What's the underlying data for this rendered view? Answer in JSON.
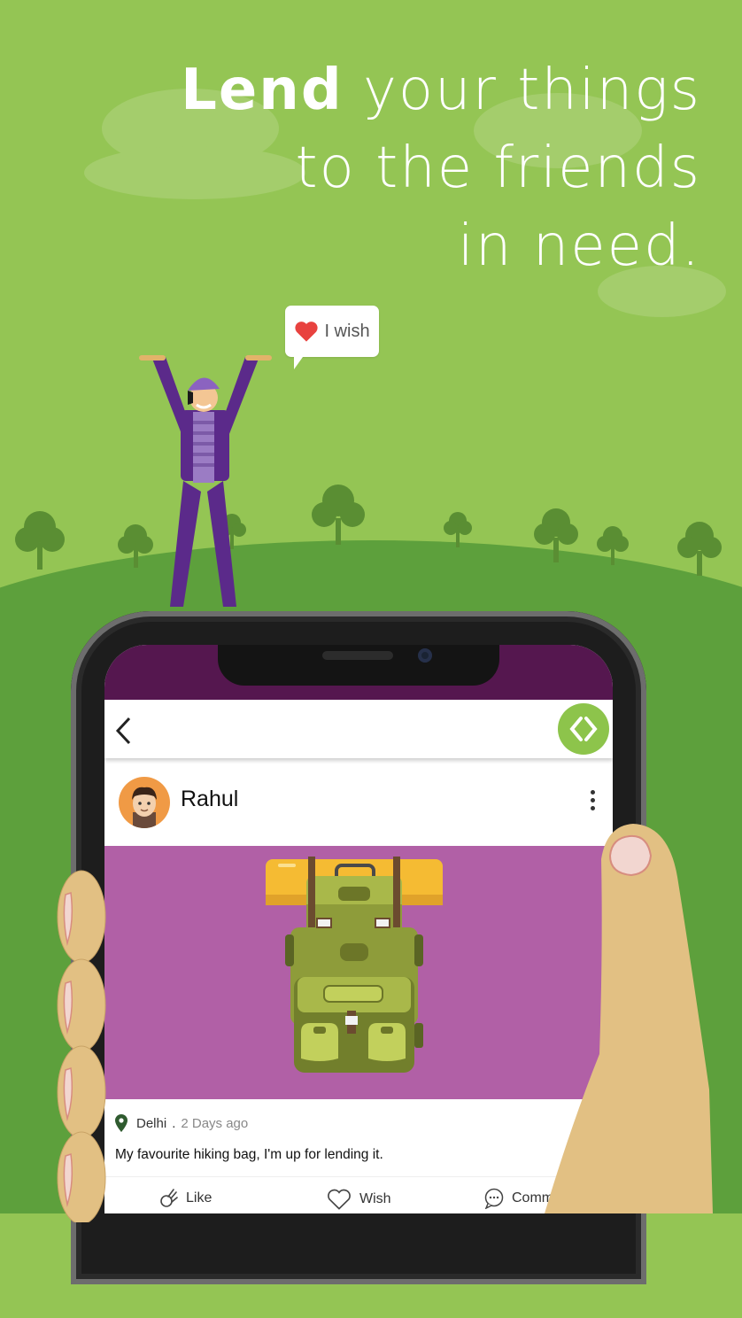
{
  "headline": {
    "line1_bold": "Lend",
    "line1_rest": " your things",
    "line2": "to the friends",
    "line3": "in need."
  },
  "speech_bubble": {
    "icon": "heart-icon",
    "text": "I wish"
  },
  "app": {
    "topbar": {
      "back_icon": "back-chevron-icon",
      "logo_icon": "app-logo-icon"
    },
    "post": {
      "username": "Rahul",
      "location": "Delhi",
      "separator": ".",
      "time": "2 Days ago",
      "caption": "My favourite hiking bag, I'm up for lending it.",
      "actions": [
        {
          "label": "Like",
          "icon": "ok-hand-icon"
        },
        {
          "label": "Wish",
          "icon": "heart-outline-icon"
        },
        {
          "label": "Comm",
          "icon": "comment-bubble-icon"
        }
      ]
    }
  },
  "colors": {
    "background": "#94c554",
    "hill": "#5da03c",
    "status_bar": "#55174f",
    "post_image_bg": "#b160a6",
    "logo": "#8dc44b",
    "avatar": "#f09a45"
  }
}
